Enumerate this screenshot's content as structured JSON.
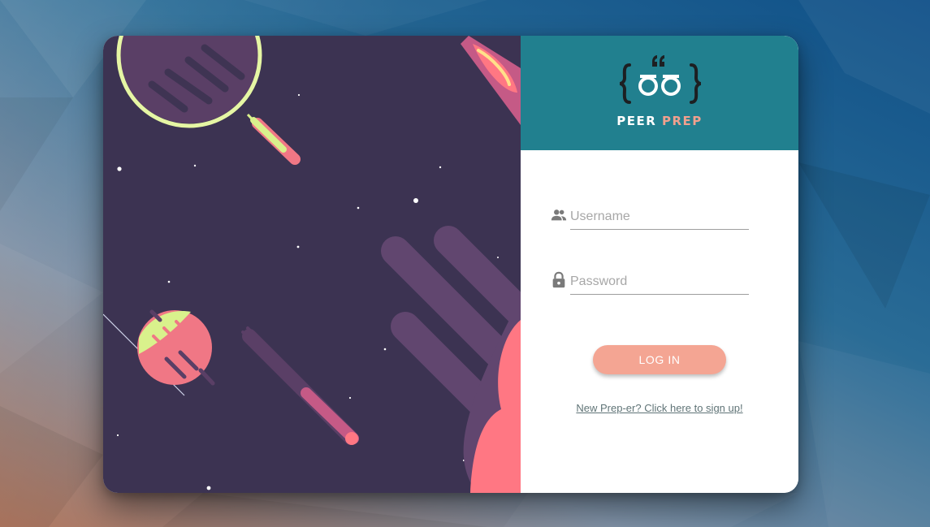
{
  "brand": {
    "word1": "PEER",
    "word2": "PREP",
    "logo_name": "peer-prep-logo"
  },
  "form": {
    "username_placeholder": "Username",
    "username_value": "",
    "username_icon": "people-icon",
    "password_placeholder": "Password",
    "password_value": "",
    "password_icon": "lock-icon",
    "login_label": "LOG IN",
    "signup_link": "New Prep-er? Click here to sign up!"
  },
  "colors": {
    "header_bg": "#21808f",
    "button_bg": "#f4a593",
    "brand_accent": "#f1a08e",
    "art_bg": "#3c3352"
  }
}
